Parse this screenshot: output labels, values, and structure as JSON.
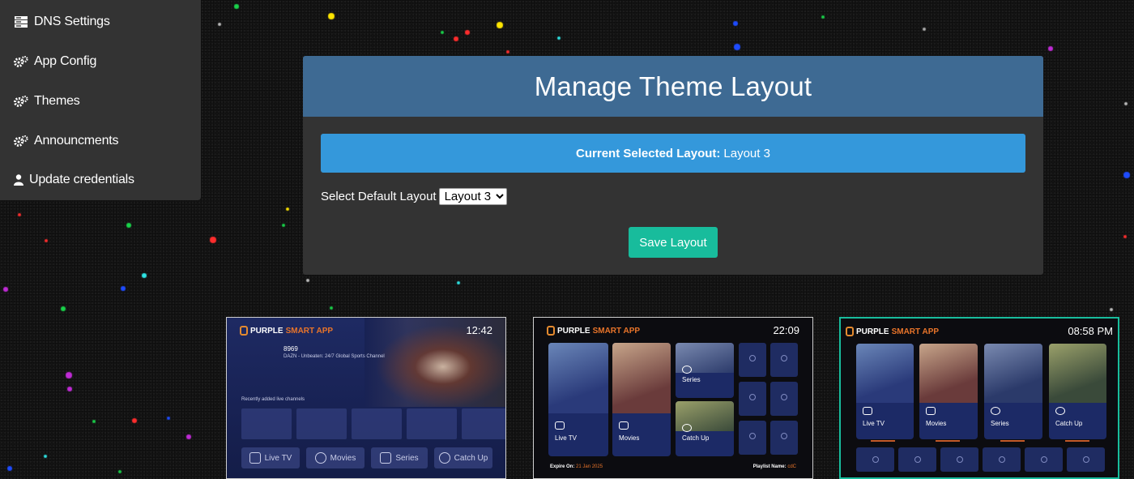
{
  "sidebar": {
    "items": [
      {
        "label": "DNS Settings",
        "icon": "server-icon"
      },
      {
        "label": "App Config",
        "icon": "gears-icon"
      },
      {
        "label": "Themes",
        "icon": "gears-icon"
      },
      {
        "label": "Announcments",
        "icon": "gears-icon"
      },
      {
        "label": "Update credentials",
        "icon": "user-icon"
      }
    ]
  },
  "panel": {
    "title": "Manage Theme Layout",
    "current_label": "Current Selected Layout:",
    "current_value": "Layout 3",
    "select_label": "Select Default Layout",
    "select_value": "Layout 3",
    "save_label": "Save Layout"
  },
  "previews": [
    {
      "logo_white": "PURPLE",
      "logo_orange": "SMART APP",
      "time": "12:42",
      "channel_number": "8969",
      "channel_name": "DAZN - Unbeaten: 24/7 Global Sports Channel",
      "recent_label": "Recently added live channels",
      "nav": [
        "Live TV",
        "Movies",
        "Series",
        "Catch Up"
      ]
    },
    {
      "logo_white": "PURPLE",
      "logo_orange": "SMART APP",
      "time": "22:09",
      "cards": [
        "Live TV",
        "Movies",
        "Series",
        "Catch Up"
      ],
      "expire_label": "Expire On:",
      "expire_value": "21 Jan 2025",
      "playlist_label": "Playlist Name:",
      "playlist_value": "cdC"
    },
    {
      "logo_white": "PURPLE",
      "logo_orange": "SMART APP",
      "time": "08:58 PM",
      "cards": [
        "Live TV",
        "Movies",
        "Series",
        "Catch Up"
      ]
    }
  ],
  "colors": {
    "header": "#3e6a93",
    "banner": "#3498db",
    "save": "#18bc9c",
    "panel": "#333333"
  }
}
